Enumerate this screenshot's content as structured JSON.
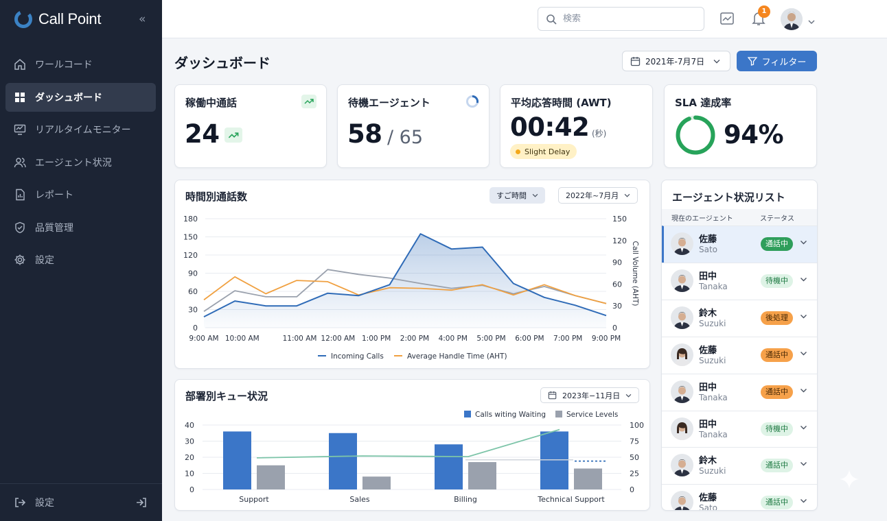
{
  "app": {
    "name": "Call Point",
    "brand_color": "#3b82c4"
  },
  "sidebar": {
    "items": [
      {
        "label": "ワールコード",
        "icon": "home-icon"
      },
      {
        "label": "ダッシュボード",
        "icon": "dashboard-grid-icon",
        "active": true
      },
      {
        "label": "リアルタイムモニター",
        "icon": "monitor-icon"
      },
      {
        "label": "エージェント状況",
        "icon": "users-icon"
      },
      {
        "label": "レポート",
        "icon": "report-file-icon"
      },
      {
        "label": "品質管理",
        "icon": "shield-check-icon"
      },
      {
        "label": "設定",
        "icon": "gear-icon"
      }
    ],
    "bottom_label": "設定"
  },
  "topbar": {
    "search_placeholder": "検索",
    "notification_count": "1"
  },
  "page": {
    "title": "ダッシュボード",
    "date_filter": "2021年-7月7日",
    "filter_label": "フィルター"
  },
  "kpis": {
    "active_calls": {
      "title": "稼働中通話",
      "value": "24"
    },
    "waiting_agents": {
      "title": "待機エージェント",
      "value": "58",
      "total": "/ 65"
    },
    "awt": {
      "title": "平均応答時間 (AWT)",
      "value": "00:42",
      "unit": "(秒)",
      "status": "Slight Delay"
    },
    "sla": {
      "title": "SLA 達成率",
      "value": "94%",
      "fraction": 0.94
    }
  },
  "hourly": {
    "title": "時間別通話数",
    "range_select": "すご時間",
    "period_select": "2022年~7月月"
  },
  "queue": {
    "title": "部署別キュー状況",
    "date_select": "2023年−11月日"
  },
  "agents": {
    "title": "エージェント状況リスト",
    "col_agent": "現在のエージェント",
    "col_status": "ステータス",
    "list": [
      {
        "name": "佐藤",
        "romaji": "Sato",
        "status": "通話中",
        "tone": "green-solid",
        "gender": "m",
        "active": true
      },
      {
        "name": "田中",
        "romaji": "Tanaka",
        "status": "待機中",
        "tone": "green",
        "gender": "m"
      },
      {
        "name": "鈴木",
        "romaji": "Suzuki",
        "status": "後処理",
        "tone": "orange",
        "gender": "m"
      },
      {
        "name": "佐藤",
        "romaji": "Suzuki",
        "status": "通話中",
        "tone": "orange",
        "gender": "f"
      },
      {
        "name": "田中",
        "romaji": "Tanaka",
        "status": "通話中",
        "tone": "orange",
        "gender": "m"
      },
      {
        "name": "田中",
        "romaji": "Tanaka",
        "status": "待機中",
        "tone": "green",
        "gender": "f"
      },
      {
        "name": "鈴木",
        "romaji": "Suzuki",
        "status": "通話中",
        "tone": "green",
        "gender": "m"
      },
      {
        "name": "佐藤",
        "romaji": "Sato",
        "status": "通話中",
        "tone": "green",
        "gender": "m"
      }
    ]
  },
  "chart_data": [
    {
      "type": "line",
      "title": "時間別通話数",
      "x": [
        "9:00 AM",
        "10:00 AM",
        "11:00 AM",
        "12:00 AM",
        "1:00 PM",
        "2:00 PM",
        "4:00 PM",
        "5:00 PM",
        "6:00 PM",
        "7:00 PM",
        "9:00 PM"
      ],
      "x_positions": [
        0,
        1,
        2.5,
        3.5,
        4.5,
        5.5,
        6.5,
        7.5,
        8.5,
        9.5,
        10.5
      ],
      "ylim": [
        0,
        180
      ],
      "yticks": [
        0,
        30,
        60,
        90,
        120,
        150,
        180
      ],
      "y2lim": [
        0,
        150
      ],
      "y2ticks": [
        0,
        30,
        60,
        90,
        120,
        150
      ],
      "y2label": "Call Volume (AHT)",
      "series": [
        {
          "name": "Incoming Calls",
          "color": "#2f6bb7",
          "axis": "left",
          "values": [
            18,
            44,
            36,
            36,
            57,
            53,
            71,
            155,
            130,
            133,
            73,
            50,
            37,
            20
          ]
        },
        {
          "name": "Average Handle Time (AHT)",
          "color": "#f0a040",
          "axis": "left",
          "values": [
            46,
            84,
            56,
            78,
            76,
            54,
            66,
            65,
            62,
            71,
            54,
            71,
            53,
            40
          ]
        },
        {
          "color": "#9aa1ad",
          "axis": "left",
          "values": [
            27,
            61,
            51,
            51,
            96,
            88,
            82,
            73,
            65,
            70,
            56,
            68,
            53,
            40
          ]
        }
      ],
      "legend": "bottom"
    },
    {
      "type": "bar",
      "title": "部署別キュー状況",
      "categories": [
        "Support",
        "Sales",
        "Billing",
        "Technical Support"
      ],
      "ylim": [
        0,
        40
      ],
      "yticks": [
        0,
        10,
        20,
        30,
        40
      ],
      "y2lim": [
        0,
        100
      ],
      "y2ticks": [
        0,
        25,
        50,
        75,
        100
      ],
      "series": [
        {
          "name": "Calls witing Waiting",
          "color": "#3b76c8",
          "values": [
            36,
            35,
            28,
            36
          ]
        },
        {
          "name": "Service Levels",
          "color": "#9aa1ad",
          "values": [
            15,
            8,
            17,
            13
          ]
        },
        {
          "color": "#7cc4a8",
          "axis": "right",
          "values": [
            49,
            52,
            51,
            93
          ]
        },
        {
          "color": "#2f6bb7",
          "axis": "right",
          "style": "dashed",
          "values": [
            44,
            44
          ]
        }
      ],
      "legend": "top-right"
    }
  ]
}
